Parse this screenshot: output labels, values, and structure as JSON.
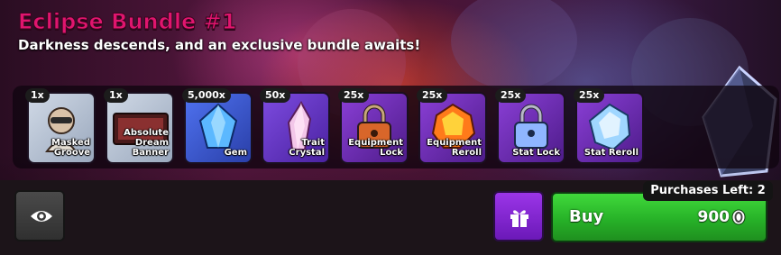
{
  "bundle": {
    "title": "Eclipse Bundle #1",
    "subtitle": "Darkness descends, and an exclusive bundle awaits!"
  },
  "items": [
    {
      "qty": "1x",
      "name_lines": [
        "Masked",
        "Groove"
      ],
      "icon": "masked-groove-icon",
      "bg": "#b9c6d6"
    },
    {
      "qty": "1x",
      "name_lines": [
        "Absolute",
        "Dream",
        "Banner"
      ],
      "icon": "banner-icon",
      "bg": "#b9c6d6"
    },
    {
      "qty": "5,000x",
      "name_lines": [
        "Gem"
      ],
      "icon": "gem-icon",
      "bg": "#3d5bd6"
    },
    {
      "qty": "50x",
      "name_lines": [
        "Trait Crystal"
      ],
      "icon": "trait-crystal-icon",
      "bg": "#6b3bd4"
    },
    {
      "qty": "25x",
      "name_lines": [
        "Equipment",
        "Lock"
      ],
      "icon": "equipment-lock-icon",
      "bg": "#7a2fc4"
    },
    {
      "qty": "25x",
      "name_lines": [
        "Equipment",
        "Reroll"
      ],
      "icon": "equipment-reroll-icon",
      "bg": "#7a2fc4"
    },
    {
      "qty": "25x",
      "name_lines": [
        "Stat Lock"
      ],
      "icon": "stat-lock-icon",
      "bg": "#7a2fc4"
    },
    {
      "qty": "25x",
      "name_lines": [
        "Stat Reroll"
      ],
      "icon": "stat-reroll-icon",
      "bg": "#7a2fc4"
    }
  ],
  "purchase": {
    "purchases_left": "Purchases Left: 2",
    "buy_label": "Buy",
    "price": "900",
    "currency_icon": "coin-icon"
  },
  "buttons": {
    "preview_icon": "eye-icon",
    "gift_icon": "gift-icon"
  },
  "colors": {
    "title": "#e0156e",
    "buy_green": "#2cc22b",
    "gift_purple": "#8a2be2"
  }
}
